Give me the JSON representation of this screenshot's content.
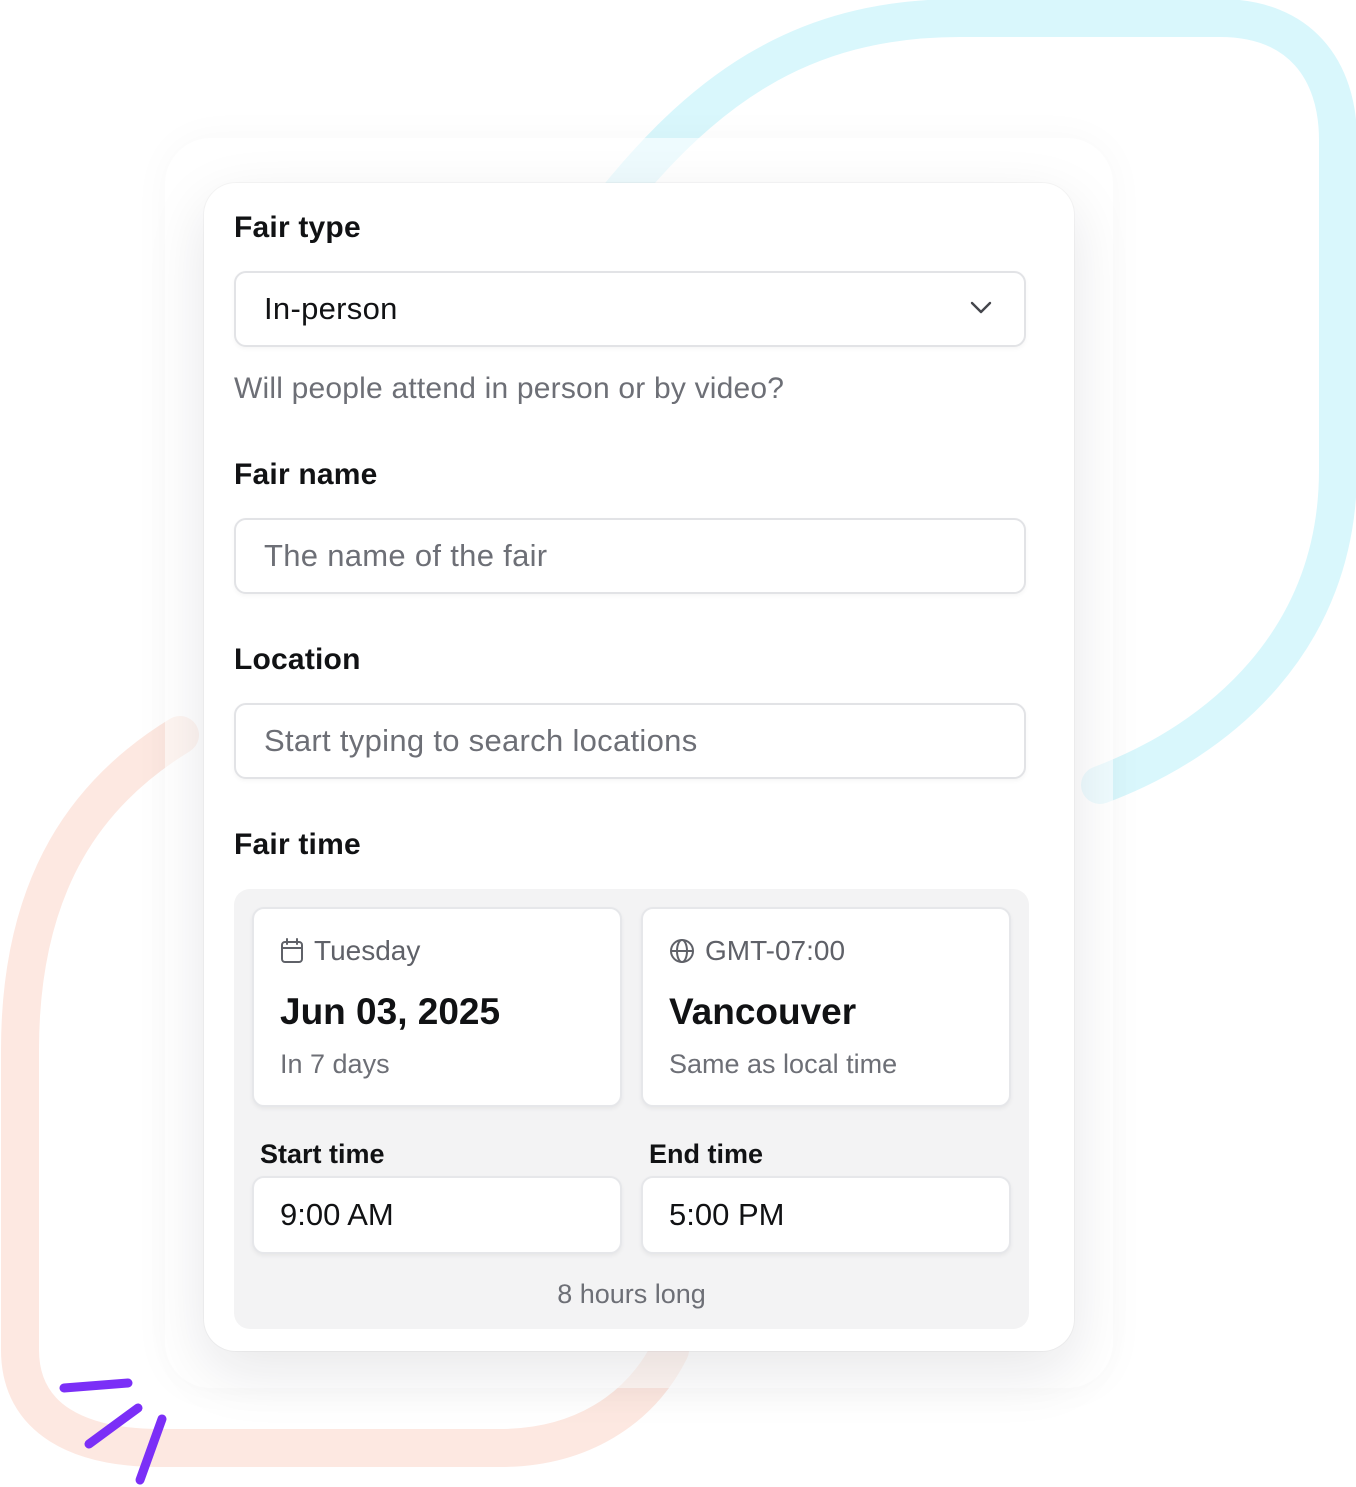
{
  "form": {
    "fair_type": {
      "label": "Fair type",
      "selected": "In-person",
      "help": "Will people attend in person or by video?"
    },
    "fair_name": {
      "label": "Fair name",
      "placeholder": "The name of the fair"
    },
    "location": {
      "label": "Location",
      "placeholder": "Start typing to search locations"
    },
    "fair_time": {
      "label": "Fair time",
      "date": {
        "icon": "calendar-icon",
        "weekday": "Tuesday",
        "date": "Jun 03, 2025",
        "relative": "In 7 days"
      },
      "timezone": {
        "icon": "globe-icon",
        "offset": "GMT-07:00",
        "city": "Vancouver",
        "note": "Same as local time"
      },
      "start": {
        "label": "Start time",
        "value": "9:00 AM"
      },
      "end": {
        "label": "End time",
        "value": "5:00 PM"
      },
      "duration": "8 hours long"
    }
  },
  "colors": {
    "decor_cyan": "#d9f7fc",
    "decor_peach": "#fde8e1",
    "decor_purple": "#7b2ff7"
  }
}
